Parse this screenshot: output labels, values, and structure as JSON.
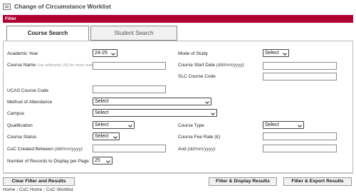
{
  "header": {
    "title": "Change of Circumstance Worklist",
    "icon": "document-list-icon"
  },
  "filter": {
    "title": "Filter",
    "tabs": {
      "course": "Course Search",
      "student": "Student Search"
    },
    "fields": {
      "academic_year": {
        "label": "Academic Year",
        "value": "24-25"
      },
      "mode_of_study": {
        "label": "Mode of Study",
        "value": "Select"
      },
      "course_name": {
        "label": "Course Name",
        "hint": "Use wildcards (%) for more matches, e.g. Math%",
        "value": ""
      },
      "course_start_date": {
        "label": "Course Start Date",
        "hint": "(dd/mm/yyyy)",
        "value": ""
      },
      "slc_course_code": {
        "label": "SLC Course Code",
        "value": ""
      },
      "ucas_course_code": {
        "label": "UCAS Course Code",
        "value": ""
      },
      "method_of_attendance": {
        "label": "Method of Attendance",
        "value": "Select"
      },
      "campus": {
        "label": "Campus",
        "value": "Select"
      },
      "qualification": {
        "label": "Qualification",
        "value": "Select"
      },
      "course_type": {
        "label": "Course Type",
        "value": "Select"
      },
      "course_status": {
        "label": "Course Status",
        "value": "Select"
      },
      "course_fee_rate": {
        "label": "Course Fee Rate (£)",
        "value": ""
      },
      "coc_created_between": {
        "label": "CoC Created Between",
        "hint": "(dd/mm/yyyy)",
        "value": ""
      },
      "and_date": {
        "label": "And",
        "hint": "(dd/mm/yyyy)",
        "value": ""
      },
      "records_per_page": {
        "label": "Number of Records to Display per Page",
        "value": "25"
      }
    }
  },
  "buttons": {
    "clear": "Clear Filter and Results",
    "display": "Filter & Display Results",
    "export": "Filter & Export Results"
  },
  "breadcrumb": [
    "Home",
    "CoC Home",
    "CoC Worklist"
  ]
}
